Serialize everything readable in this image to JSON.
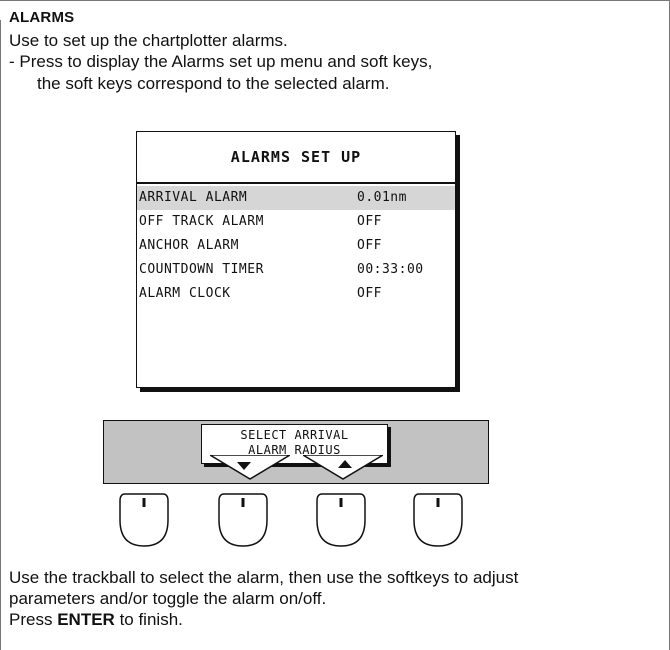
{
  "section": {
    "heading": "ALARMS",
    "intro_line1": "Use to set up the chartplotter alarms.",
    "intro_line2": "- Press to display the Alarms set up menu and soft keys,",
    "intro_line3": "the soft keys correspond to the selected alarm."
  },
  "menu": {
    "title": "ALARMS SET UP",
    "rows": [
      {
        "name": "ARRIVAL ALARM",
        "value": "0.01nm",
        "selected": true
      },
      {
        "name": "OFF TRACK ALARM",
        "value": "OFF",
        "selected": false
      },
      {
        "name": "ANCHOR ALARM",
        "value": "OFF",
        "selected": false
      },
      {
        "name": "COUNTDOWN TIMER",
        "value": "00:33:00",
        "selected": false
      },
      {
        "name": "ALARM CLOCK",
        "value": "OFF",
        "selected": false
      }
    ]
  },
  "softkey_label": {
    "line1": "SELECT ARRIVAL",
    "line2": "ALARM RADIUS"
  },
  "footer": {
    "line1": "Use the trackball to select the alarm, then use the softkeys to adjust",
    "line2": "parameters and/or toggle the alarm on/off.",
    "press": "Press",
    "enter": "ENTER",
    "finish": "to finish."
  },
  "colors": {
    "selected_row": "#d6d6d6",
    "softkey_bar": "#c2c2c2"
  }
}
